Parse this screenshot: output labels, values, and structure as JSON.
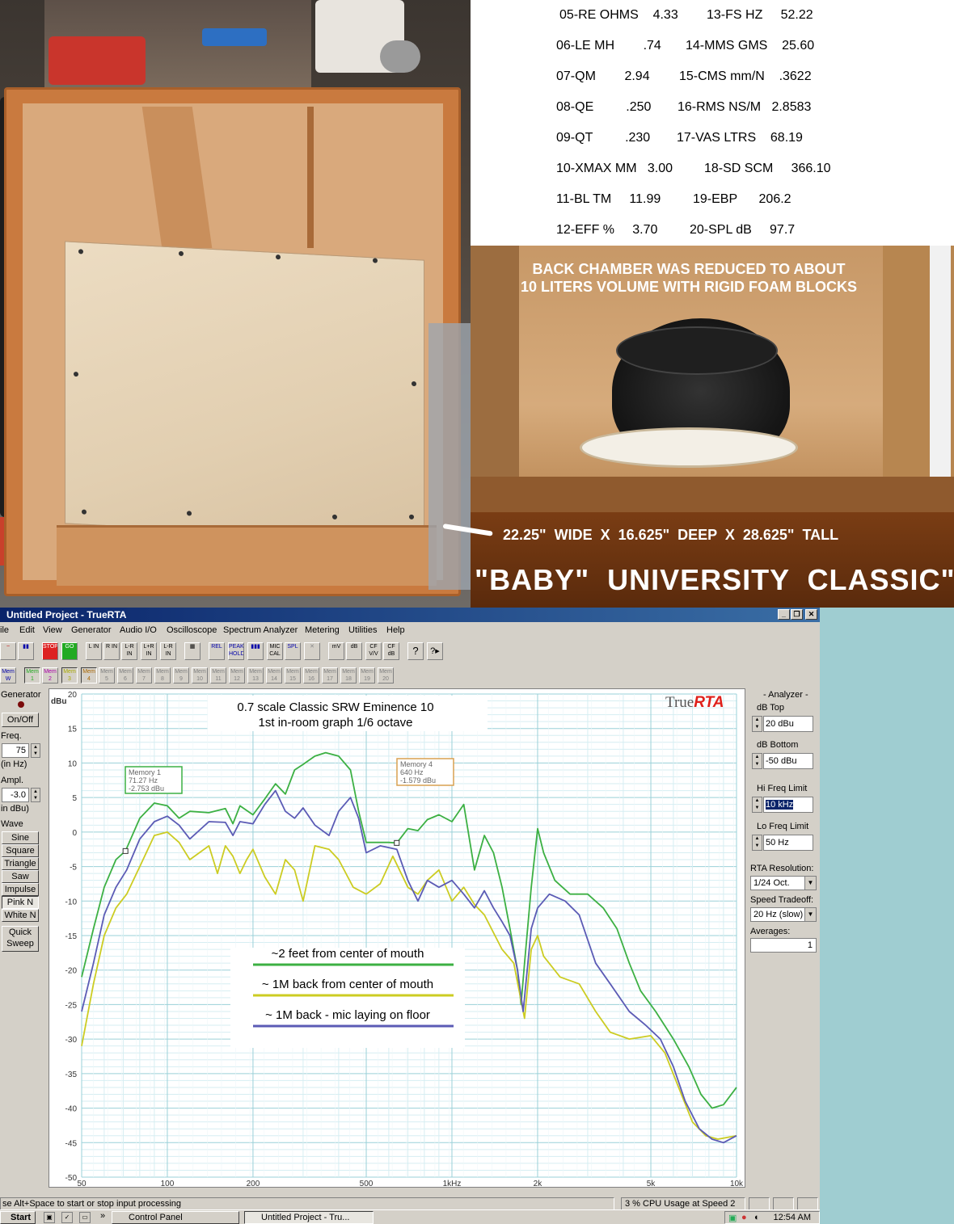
{
  "specs": [
    {
      "left": "05-RE OHMS    4.33",
      "right": "13-FS HZ     52.22"
    },
    {
      "left": "06-LE MH        .74",
      "right": "14-MMS GMS    25.60"
    },
    {
      "left": "07-QM        2.94",
      "right": "15-CMS mm/N    .3622"
    },
    {
      "left": "08-QE         .250",
      "right": "16-RMS NS/M   2.8583"
    },
    {
      "left": "09-QT         .230",
      "right": "17-VAS LTRS    68.19"
    },
    {
      "left": "10-XMAX MM   3.00",
      "right": "18-SD SCM     366.10"
    },
    {
      "left": "11-BL TM     11.99",
      "right": "19-EBP      206.2"
    },
    {
      "left": "12-EFF %     3.70",
      "right": "20-SPL dB     97.7"
    }
  ],
  "back_caption_line1": "BACK CHAMBER WAS REDUCED TO ABOUT",
  "back_caption_line2": "10 LITERS VOLUME WITH RIGID FOAM BLOCKS",
  "dimensions": "22.25\"  WIDE  X  16.625\"  DEEP  X  28.625\"  TALL",
  "big_title": "\"BABY\"  UNIVERSITY  CLASSIC\"",
  "app": {
    "title": "Untitled Project - TrueRTA",
    "menu": [
      "ile",
      "Edit",
      "View",
      "Generator",
      "Audio I/O",
      "Oscilloscope",
      "Spectrum Analyzer",
      "Metering",
      "Utilities",
      "Help"
    ],
    "toolbar": [
      "~",
      "▮▮",
      "STOP",
      "GO",
      "L IN",
      "R IN",
      "L-R IN",
      "L+R IN",
      "L-R IN",
      "▦",
      "REL",
      "PEAK HOLD",
      "▮▮▮",
      "MIC CAL",
      "SPL",
      "✕",
      "mV",
      "dB",
      "CF V/V",
      "CF dB",
      "?",
      "?▸"
    ],
    "mem_labels": [
      "Mem W",
      "Mem 1",
      "Mem 2",
      "Mem 3",
      "Mem 4",
      "Mem 5",
      "Mem 6",
      "Mem 7",
      "Mem 8",
      "Mem 9",
      "Mem 10",
      "Mem 11",
      "Mem 12",
      "Mem 13",
      "Mem 14",
      "Mem 15",
      "Mem 16",
      "Mem 17",
      "Mem 18",
      "Mem 19",
      "Mem 20"
    ],
    "generator": {
      "header": "Generator",
      "onoff": "On/Off",
      "freq_label": "Freq.",
      "freq_value": "75",
      "freq_unit": "(in Hz)",
      "ampl_label": "Ampl.",
      "ampl_value": "-3.0",
      "ampl_unit": "in dBu)",
      "wave_label": "Wave",
      "waves": [
        "Sine",
        "Square",
        "Triangle",
        "Saw",
        "Impulse",
        "Pink N",
        "White N"
      ],
      "quick_sweep_1": "Quick",
      "quick_sweep_2": "Sweep"
    },
    "analyzer": {
      "header": "- Analyzer -",
      "db_top_label": "dB Top",
      "db_top_value": "20 dBu",
      "db_bottom_label": "dB Bottom",
      "db_bottom_value": "-50 dBu",
      "hi_freq_label": "Hi Freq Limit",
      "hi_freq_value": "10 kHz",
      "lo_freq_label": "Lo Freq Limit",
      "lo_freq_value": "50 Hz",
      "rta_res_label": "RTA Resolution:",
      "rta_res_value": "1/24 Oct.",
      "speed_label": "Speed Tradeoff:",
      "speed_value": "20 Hz (slow)",
      "averages_label": "Averages:",
      "averages_value": "1"
    },
    "status_left": "se Alt+Space to start or stop input processing",
    "status_right": "3 % CPU Usage at Speed 2"
  },
  "taskbar": {
    "start": "Start",
    "tasks": [
      "Control Panel",
      "Untitled Project - Tru..."
    ],
    "clock": "12:54 AM"
  },
  "chart_data": {
    "type": "line",
    "title": "0.7 scale Classic   SRW Eminence 10",
    "subtitle": "1st in-room graph  1/6 octave",
    "brand": "TrueRTA",
    "ylabel": "dBu",
    "ylim": [
      -50,
      20
    ],
    "xlim": [
      50,
      10000
    ],
    "xscale": "log",
    "yticks": [
      20,
      15,
      10,
      5,
      0,
      -5,
      -10,
      -15,
      -20,
      -25,
      -30,
      -35,
      -40,
      -45,
      -50
    ],
    "xticks": [
      {
        "v": 50,
        "label": "50"
      },
      {
        "v": 100,
        "label": "100"
      },
      {
        "v": 200,
        "label": "200"
      },
      {
        "v": 500,
        "label": "500"
      },
      {
        "v": 1000,
        "label": "1kHz"
      },
      {
        "v": 2000,
        "label": "2k"
      },
      {
        "v": 5000,
        "label": "5k"
      },
      {
        "v": 10000,
        "label": "10k"
      }
    ],
    "grid": true,
    "series": [
      {
        "name": "~2 feet from center of mouth",
        "color": "#3cb043",
        "points": [
          [
            50,
            -21
          ],
          [
            55,
            -14
          ],
          [
            60,
            -8
          ],
          [
            66,
            -4
          ],
          [
            71.27,
            -2.75
          ],
          [
            80,
            2
          ],
          [
            90,
            4.2
          ],
          [
            100,
            3.8
          ],
          [
            110,
            2
          ],
          [
            120,
            3
          ],
          [
            140,
            2.8
          ],
          [
            160,
            3.4
          ],
          [
            170,
            1.2
          ],
          [
            180,
            3.8
          ],
          [
            200,
            2.5
          ],
          [
            220,
            4.8
          ],
          [
            240,
            7
          ],
          [
            260,
            5.5
          ],
          [
            280,
            9
          ],
          [
            300,
            9.8
          ],
          [
            330,
            11
          ],
          [
            360,
            11.5
          ],
          [
            400,
            11
          ],
          [
            440,
            9
          ],
          [
            470,
            3
          ],
          [
            500,
            -1.5
          ],
          [
            560,
            -1.5
          ],
          [
            600,
            -1.5
          ],
          [
            640,
            -1.58
          ],
          [
            700,
            0.5
          ],
          [
            760,
            0.2
          ],
          [
            820,
            1.8
          ],
          [
            900,
            2.5
          ],
          [
            1000,
            1.5
          ],
          [
            1100,
            4
          ],
          [
            1200,
            -5.5
          ],
          [
            1300,
            -0.5
          ],
          [
            1400,
            -3
          ],
          [
            1500,
            -8
          ],
          [
            1600,
            -14
          ],
          [
            1700,
            -20
          ],
          [
            1750,
            -25
          ],
          [
            1800,
            -19
          ],
          [
            1900,
            -8
          ],
          [
            2000,
            0.5
          ],
          [
            2100,
            -3
          ],
          [
            2300,
            -7
          ],
          [
            2600,
            -9
          ],
          [
            3000,
            -9
          ],
          [
            3400,
            -11
          ],
          [
            3800,
            -14
          ],
          [
            4200,
            -19
          ],
          [
            4600,
            -23
          ],
          [
            5200,
            -26
          ],
          [
            6000,
            -30
          ],
          [
            6800,
            -34
          ],
          [
            7500,
            -38
          ],
          [
            8200,
            -40
          ],
          [
            9000,
            -39.5
          ],
          [
            10000,
            -37
          ]
        ]
      },
      {
        "name": "~ 1M back from center of mouth",
        "color": "#cccc22",
        "points": [
          [
            50,
            -31
          ],
          [
            55,
            -22
          ],
          [
            60,
            -15
          ],
          [
            66,
            -11
          ],
          [
            72,
            -9
          ],
          [
            80,
            -5
          ],
          [
            90,
            -0.5
          ],
          [
            100,
            0
          ],
          [
            110,
            -1.5
          ],
          [
            120,
            -4
          ],
          [
            140,
            -2
          ],
          [
            150,
            -6
          ],
          [
            160,
            -2
          ],
          [
            170,
            -3.5
          ],
          [
            180,
            -6
          ],
          [
            190,
            -4
          ],
          [
            200,
            -2.5
          ],
          [
            220,
            -6.5
          ],
          [
            240,
            -9
          ],
          [
            260,
            -4
          ],
          [
            280,
            -5.5
          ],
          [
            300,
            -10
          ],
          [
            330,
            -2
          ],
          [
            370,
            -2.5
          ],
          [
            400,
            -4
          ],
          [
            450,
            -8
          ],
          [
            500,
            -9
          ],
          [
            560,
            -7.5
          ],
          [
            620,
            -3.5
          ],
          [
            700,
            -8
          ],
          [
            760,
            -9
          ],
          [
            820,
            -7
          ],
          [
            900,
            -5.5
          ],
          [
            1000,
            -10
          ],
          [
            1100,
            -8
          ],
          [
            1200,
            -10.5
          ],
          [
            1300,
            -12
          ],
          [
            1500,
            -17
          ],
          [
            1650,
            -19
          ],
          [
            1800,
            -27
          ],
          [
            1900,
            -17
          ],
          [
            2000,
            -15
          ],
          [
            2100,
            -18
          ],
          [
            2400,
            -21
          ],
          [
            2800,
            -22
          ],
          [
            3200,
            -26
          ],
          [
            3600,
            -29
          ],
          [
            4200,
            -30
          ],
          [
            5000,
            -29.5
          ],
          [
            5600,
            -32
          ],
          [
            6400,
            -38
          ],
          [
            7000,
            -42
          ],
          [
            7800,
            -44
          ],
          [
            8600,
            -44.5
          ],
          [
            10000,
            -44
          ]
        ]
      },
      {
        "name": "~ 1M back - mic laying on floor",
        "color": "#5b5bb5",
        "points": [
          [
            50,
            -26
          ],
          [
            55,
            -19
          ],
          [
            60,
            -12
          ],
          [
            66,
            -8
          ],
          [
            72,
            -5.5
          ],
          [
            80,
            -1
          ],
          [
            90,
            1.5
          ],
          [
            100,
            2.3
          ],
          [
            110,
            1
          ],
          [
            120,
            -1
          ],
          [
            140,
            1.5
          ],
          [
            160,
            1.4
          ],
          [
            170,
            -0.5
          ],
          [
            180,
            1.5
          ],
          [
            200,
            1.2
          ],
          [
            220,
            4
          ],
          [
            240,
            6
          ],
          [
            260,
            3
          ],
          [
            280,
            2
          ],
          [
            300,
            3.5
          ],
          [
            330,
            1
          ],
          [
            370,
            -0.5
          ],
          [
            400,
            3
          ],
          [
            440,
            5
          ],
          [
            470,
            2
          ],
          [
            500,
            -3
          ],
          [
            560,
            -2
          ],
          [
            640,
            -2.5
          ],
          [
            700,
            -7
          ],
          [
            760,
            -10
          ],
          [
            820,
            -7
          ],
          [
            900,
            -8
          ],
          [
            1000,
            -7
          ],
          [
            1100,
            -9
          ],
          [
            1200,
            -11
          ],
          [
            1300,
            -8.5
          ],
          [
            1400,
            -11
          ],
          [
            1500,
            -13
          ],
          [
            1600,
            -15
          ],
          [
            1700,
            -20
          ],
          [
            1780,
            -26
          ],
          [
            1900,
            -14
          ],
          [
            2000,
            -11
          ],
          [
            2200,
            -9
          ],
          [
            2500,
            -10
          ],
          [
            2800,
            -12
          ],
          [
            3200,
            -19
          ],
          [
            3600,
            -22
          ],
          [
            4200,
            -26
          ],
          [
            4800,
            -28
          ],
          [
            5400,
            -30
          ],
          [
            6000,
            -34
          ],
          [
            6600,
            -39
          ],
          [
            7400,
            -43
          ],
          [
            8200,
            -44.5
          ],
          [
            9000,
            -45
          ],
          [
            10000,
            -44
          ]
        ]
      }
    ],
    "markers": [
      {
        "label": "Memory 1",
        "line2": "71.27 Hz",
        "line3": "-2.753 dBu",
        "x": 71.27,
        "y": -2.753,
        "color": "#3cb043"
      },
      {
        "label": "Memory 4",
        "line2": "640 Hz",
        "line3": "-1.579 dBu",
        "x": 640,
        "y": -1.579,
        "color": "#d9a050"
      }
    ]
  }
}
